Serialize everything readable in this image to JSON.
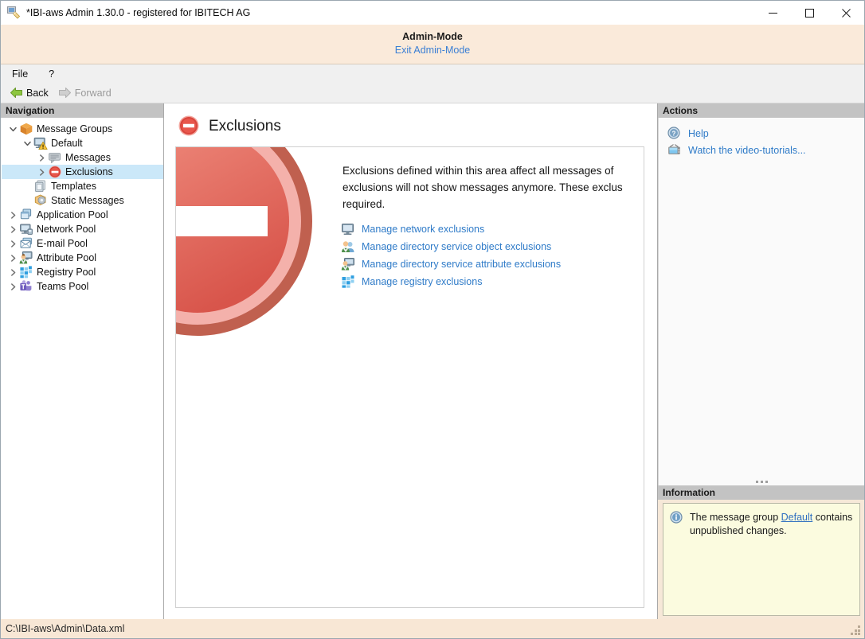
{
  "window": {
    "app_icon": "pen-document-icon",
    "title": "*IBI-aws Admin 1.30.0 - registered for IBITECH AG",
    "minimize_label": "—",
    "maximize_label": "☐",
    "close_label": "✕"
  },
  "admin_banner": {
    "title": "Admin-Mode",
    "exit_link": "Exit Admin-Mode"
  },
  "menubar": {
    "items": [
      {
        "label": "File",
        "name": "menu-file"
      },
      {
        "label": "?",
        "name": "menu-help"
      }
    ]
  },
  "navtoolbar": {
    "back_label": "Back",
    "forward_label": "Forward"
  },
  "navigation": {
    "header": "Navigation",
    "items": [
      {
        "label": "Message Groups",
        "indent": 0,
        "twist": "down",
        "icon": "package-icon",
        "selected": false
      },
      {
        "label": "Default",
        "indent": 1,
        "twist": "down",
        "icon": "monitor-warning-icon",
        "selected": false
      },
      {
        "label": "Messages",
        "indent": 2,
        "twist": "right",
        "icon": "message-bubble-icon",
        "selected": false
      },
      {
        "label": "Exclusions",
        "indent": 2,
        "twist": "right",
        "icon": "no-entry-icon",
        "selected": true
      },
      {
        "label": "Templates",
        "indent": 1,
        "twist": "none",
        "icon": "templates-icon",
        "selected": false
      },
      {
        "label": "Static Messages",
        "indent": 1,
        "twist": "none",
        "icon": "static-messages-icon",
        "selected": false
      },
      {
        "label": "Application Pool",
        "indent": 0,
        "twist": "right",
        "icon": "application-pool-icon",
        "selected": false
      },
      {
        "label": "Network Pool",
        "indent": 0,
        "twist": "right",
        "icon": "network-pool-icon",
        "selected": false
      },
      {
        "label": "E-mail Pool",
        "indent": 0,
        "twist": "right",
        "icon": "email-pool-icon",
        "selected": false
      },
      {
        "label": "Attribute Pool",
        "indent": 0,
        "twist": "right",
        "icon": "attribute-pool-icon",
        "selected": false
      },
      {
        "label": "Registry Pool",
        "indent": 0,
        "twist": "right",
        "icon": "registry-pool-icon",
        "selected": false
      },
      {
        "label": "Teams Pool",
        "indent": 0,
        "twist": "right",
        "icon": "teams-pool-icon",
        "selected": false
      }
    ]
  },
  "content": {
    "page_icon": "no-entry-icon",
    "page_title": "Exclusions",
    "hero_graphic": "no-entry-sign-graphic",
    "description_line1": "Exclusions defined within this area affect all messages of",
    "description_line2": "exclusions will not show messages anymore. These exclus",
    "description_line3": "required.",
    "links": [
      {
        "label": "Manage network exclusions",
        "icon": "monitor-icon",
        "name": "link-manage-network-exclusions"
      },
      {
        "label": "Manage directory service object exclusions",
        "icon": "users-icon",
        "name": "link-manage-ds-object-exclusions"
      },
      {
        "label": "Manage directory service attribute exclusions",
        "icon": "user-monitor-icon",
        "name": "link-manage-ds-attribute-exclusions"
      },
      {
        "label": "Manage registry exclusions",
        "icon": "registry-icon",
        "name": "link-manage-registry-exclusions"
      }
    ]
  },
  "actions": {
    "header": "Actions",
    "items": [
      {
        "label": "Help",
        "icon": "help-icon",
        "name": "action-help"
      },
      {
        "label": "Watch the video-tutorials...",
        "icon": "video-icon",
        "name": "action-video-tutorials"
      }
    ]
  },
  "information": {
    "header": "Information",
    "icon": "info-icon",
    "text_before": "The message group ",
    "link": "Default",
    "text_after": " contains unpublished changes."
  },
  "statusbar": {
    "path": "C:\\IBI-aws\\Admin\\Data.xml"
  },
  "colors": {
    "accent_link": "#2f7bc8",
    "admin_banner_bg": "#faeada",
    "selection": "#cbe8f9",
    "info_bg": "#fbfbdf",
    "sign_red": "#e0574e"
  }
}
